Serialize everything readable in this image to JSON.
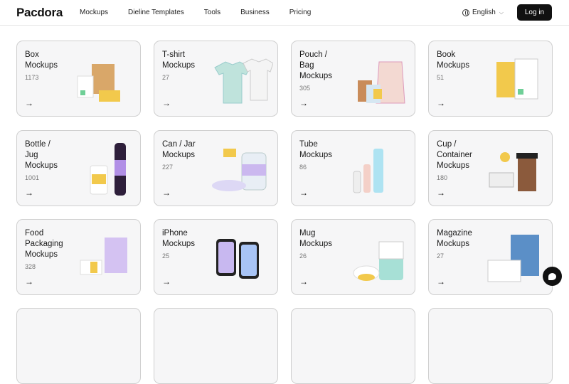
{
  "header": {
    "logo": "Pacdora",
    "nav": [
      "Mockups",
      "Dieline Templates",
      "Tools",
      "Business",
      "Pricing"
    ],
    "language": "English",
    "login": "Log in"
  },
  "cards": [
    {
      "title": "Box\nMockups",
      "count": "1173"
    },
    {
      "title": "T-shirt\nMockups",
      "count": "27"
    },
    {
      "title": "Pouch /\nBag\nMockups",
      "count": "305"
    },
    {
      "title": "Book\nMockups",
      "count": "51"
    },
    {
      "title": "Bottle /\nJug\nMockups",
      "count": "1001"
    },
    {
      "title": "Can / Jar\nMockups",
      "count": "227"
    },
    {
      "title": "Tube\nMockups",
      "count": "86"
    },
    {
      "title": "Cup /\nContainer\nMockups",
      "count": "180"
    },
    {
      "title": "Food\nPackaging\nMockups",
      "count": "328"
    },
    {
      "title": "iPhone\nMockups",
      "count": "25"
    },
    {
      "title": "Mug\nMockups",
      "count": "26"
    },
    {
      "title": "Magazine\nMockups",
      "count": "27"
    }
  ],
  "arrow": "→",
  "icons": {
    "language": "globe-icon",
    "chat": "chat-icon",
    "card_arrow": "arrow-right-icon"
  },
  "colors": {
    "login_bg": "#111111",
    "card_bg": "#f6f6f7",
    "card_border": "#cfcfcf"
  }
}
